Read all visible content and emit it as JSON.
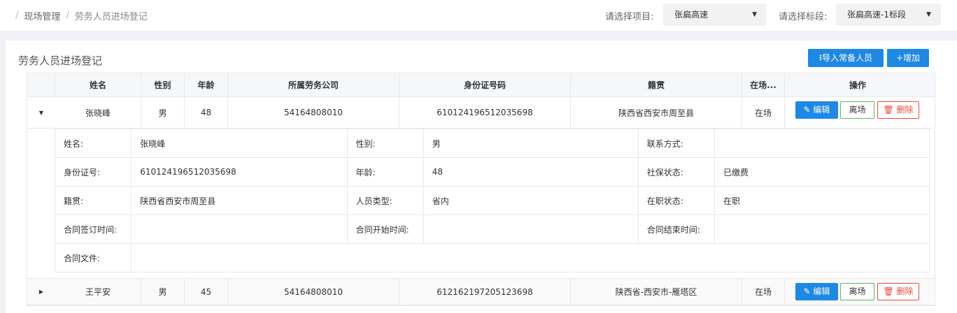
{
  "breadcrumb": {
    "items": [
      "现场管理",
      "劳务人员进场登记"
    ]
  },
  "filters": {
    "project_label": "请选择项目:",
    "project_value": "张扁高速",
    "section_label": "请选择标段:",
    "section_value": "张扁高速-1标段"
  },
  "card": {
    "title": "劳务人员进场登记",
    "import_label": "导入常备人员",
    "add_label": "增加"
  },
  "table": {
    "columns": [
      "姓名",
      "性别",
      "年龄",
      "所属劳务公司",
      "身份证号码",
      "籍贯",
      "在场...",
      "操作"
    ],
    "actions": {
      "edit": "编辑",
      "leave": "离场",
      "delete": "删除"
    },
    "rows": [
      {
        "name": "张晓峰",
        "gender": "男",
        "age": "48",
        "company": "54164808010",
        "id_number": "610124196512035698",
        "origin": "陕西省西安市周至县",
        "status": "在场",
        "expanded": true
      },
      {
        "name": "王平安",
        "gender": "男",
        "age": "45",
        "company": "54164808010",
        "id_number": "612162197205123698",
        "origin": "陕西省-西安市-雁塔区",
        "status": "在场",
        "expanded": false
      }
    ]
  },
  "detail": {
    "labels": {
      "name": "姓名:",
      "gender": "性别:",
      "contact": "联系方式:",
      "id": "身份证号:",
      "age": "年龄:",
      "insurance": "社保状态:",
      "origin": "籍贯:",
      "type": "人员类型:",
      "employment": "在职状态:",
      "sign_time": "合同签订时间:",
      "start_time": "合同开始时间:",
      "end_time": "合同结束时间:",
      "contract_file": "合同文件:"
    },
    "values": {
      "name": "张晓峰",
      "gender": "男",
      "contact": "",
      "id": "610124196512035698",
      "age": "48",
      "insurance": "已缴费",
      "origin": "陕西省西安市周至县",
      "type": "省内",
      "employment": "在职",
      "sign_time": "",
      "start_time": "",
      "end_time": "",
      "contract_file": ""
    }
  },
  "colors": {
    "primary": "#1e88e5",
    "success": "#5cb85c",
    "danger": "#e74c3c"
  },
  "icons": {
    "upload": "upload-icon",
    "plus": "plus-icon",
    "edit": "pencil-icon",
    "delete": "trash-icon",
    "caret": "caret-down-icon",
    "expand": "triangle-icon"
  }
}
